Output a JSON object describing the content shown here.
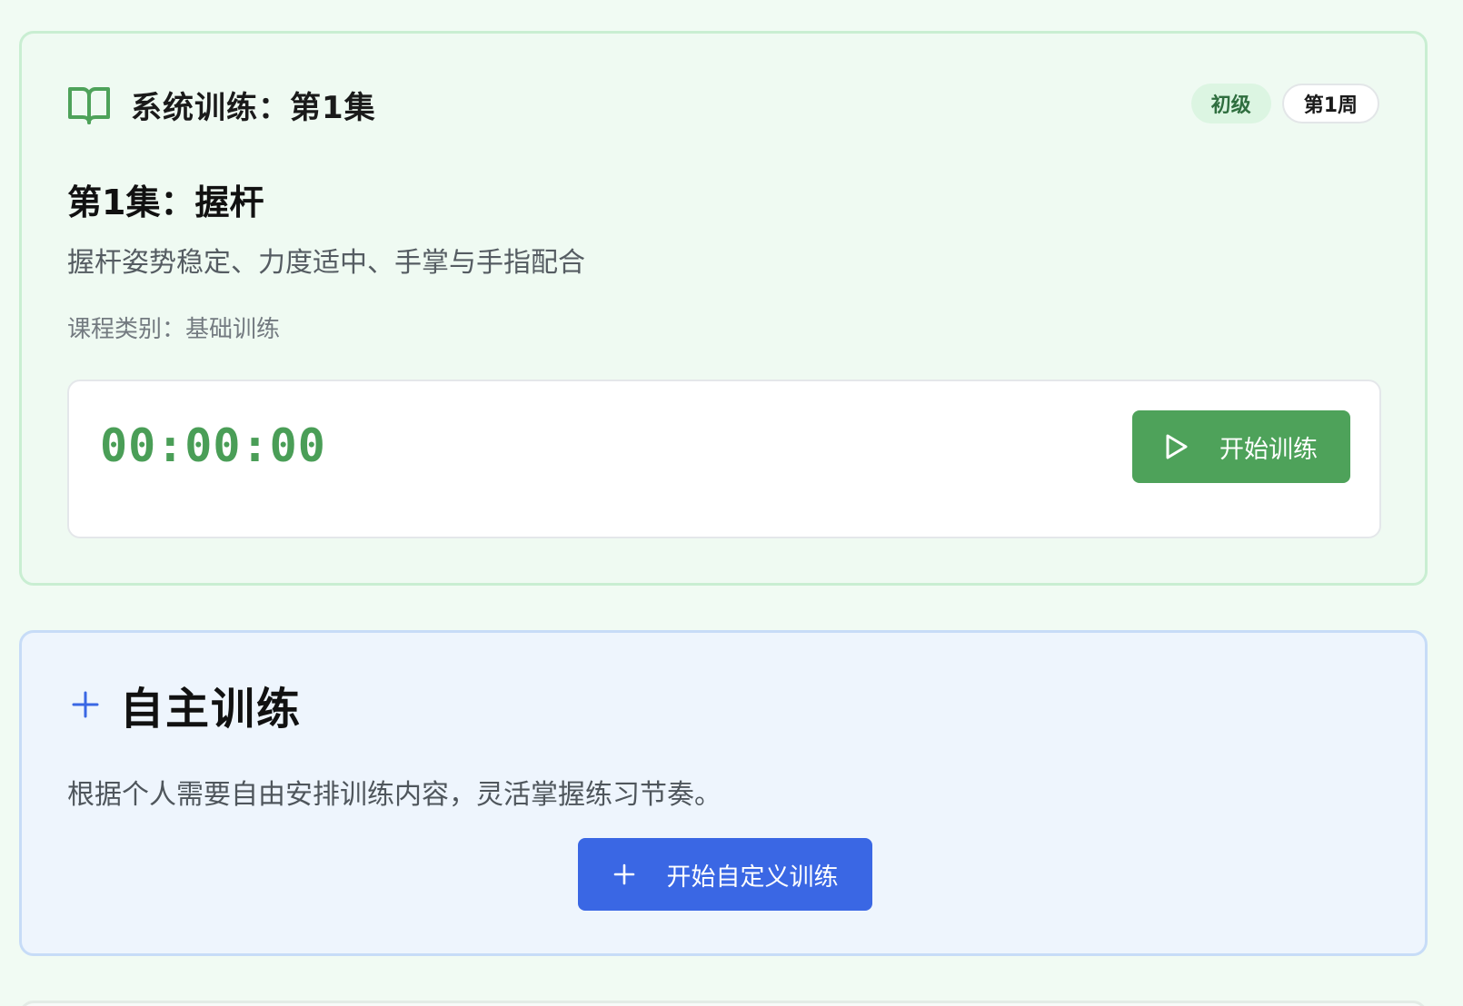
{
  "system_training": {
    "title": "系统训练：第1集",
    "icon": "book-open-icon",
    "badges": {
      "level": "初级",
      "week": "第1周"
    },
    "lesson_title": "第1集：握杆",
    "lesson_description": "握杆姿势稳定、力度适中、手掌与手指配合",
    "category": "课程类别：基础训练",
    "timer": "00:00:00",
    "start_button": {
      "label": "开始训练",
      "icon": "play-icon"
    },
    "accent_color": "#4ea25a"
  },
  "custom_training": {
    "title": "自主训练",
    "icon": "plus-icon",
    "description": "根据个人需要自由安排训练内容，灵活掌握练习节奏。",
    "start_button": {
      "label": "开始自定义训练",
      "icon": "plus-icon"
    },
    "accent_color": "#3a67e4"
  }
}
